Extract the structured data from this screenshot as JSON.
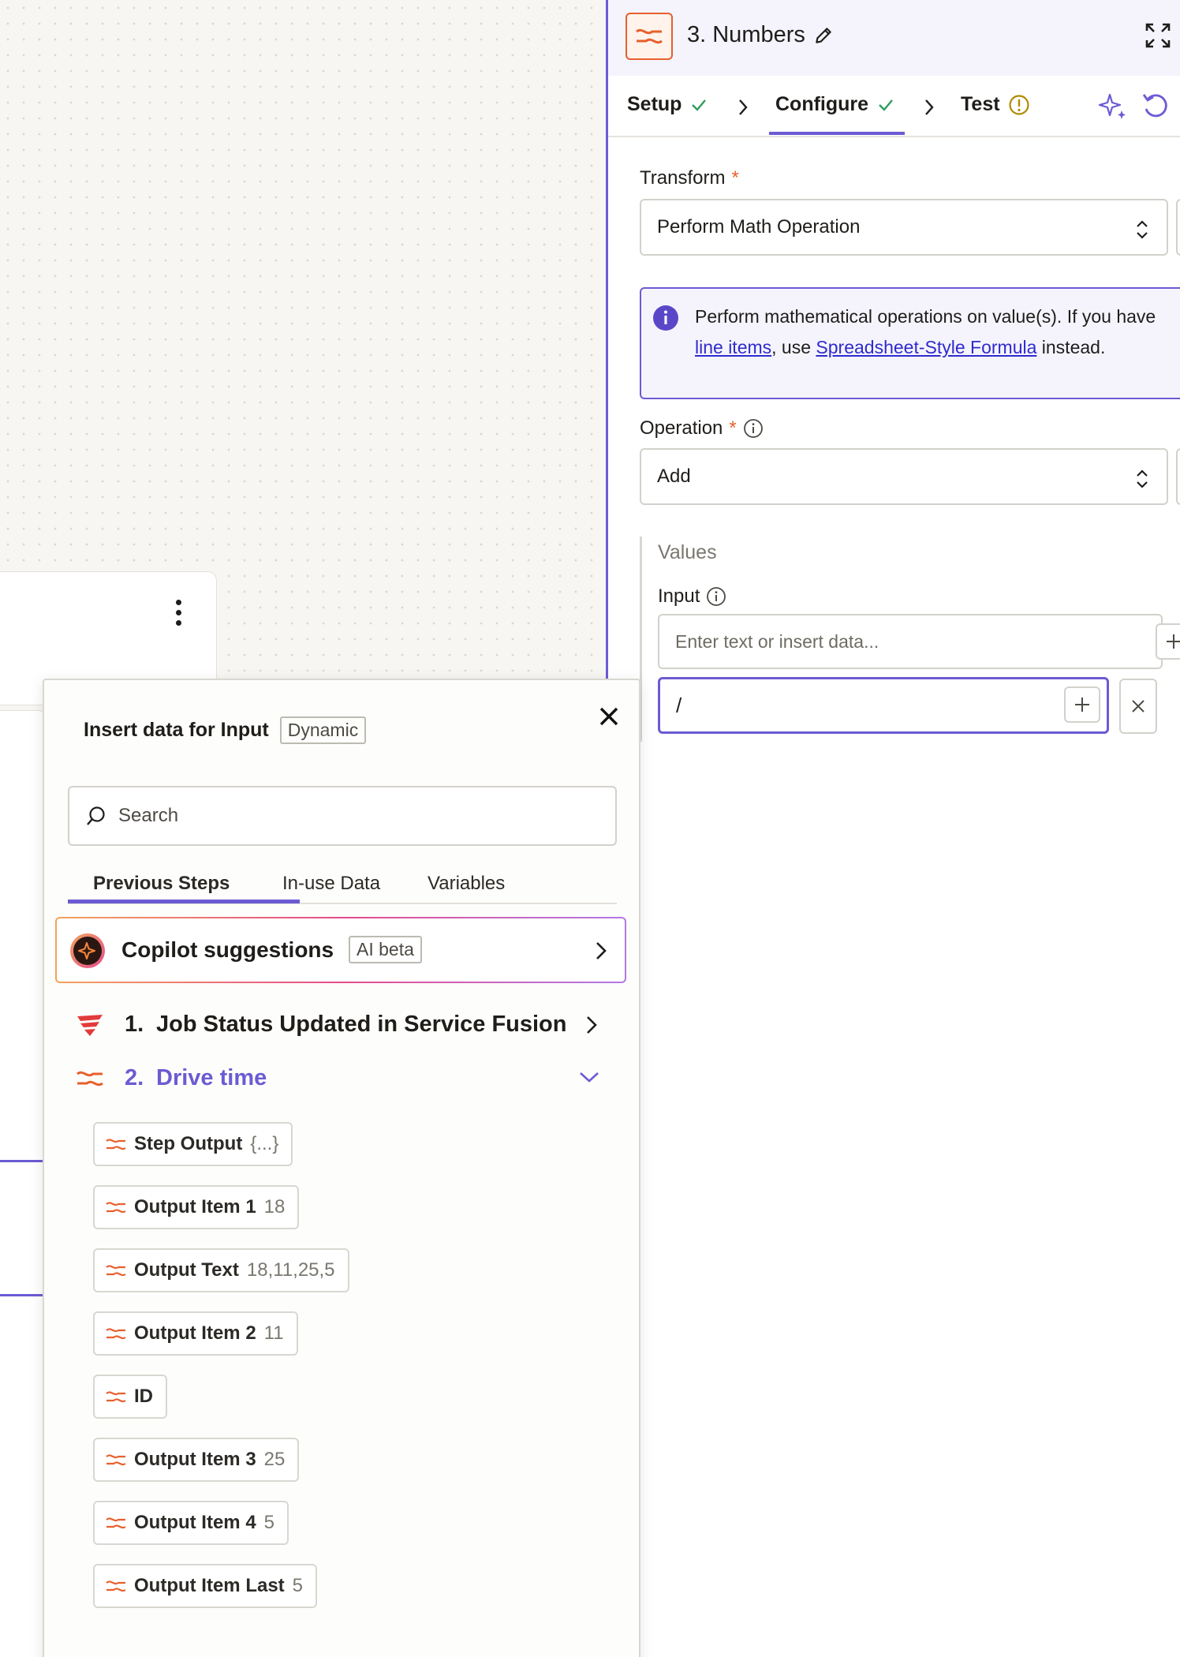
{
  "panel": {
    "title": "3. Numbers",
    "steps": [
      {
        "label": "Setup",
        "status": "done"
      },
      {
        "label": "Configure",
        "status": "done"
      },
      {
        "label": "Test",
        "status": "warning"
      }
    ],
    "transform": {
      "label": "Transform",
      "required_mark": "*",
      "value": "Perform Math Operation"
    },
    "info": {
      "text_before": "Perform mathematical operations on value(s). If you have ",
      "link1": "line items",
      "text_middle": ", use ",
      "link2": "Spreadsheet-Style Formula",
      "text_after": " instead."
    },
    "operation": {
      "label": "Operation",
      "required_mark": "*",
      "value": "Add"
    },
    "values": {
      "group_label": "Values",
      "input_label": "Input",
      "input_placeholder": "Enter text or insert data...",
      "active_input_value": "/"
    }
  },
  "popover": {
    "title": "Insert data for Input",
    "badge": "Dynamic",
    "search_placeholder": "Search",
    "tabs": [
      "Previous Steps",
      "In-use Data",
      "Variables"
    ],
    "copilot": {
      "label": "Copilot suggestions",
      "badge": "AI beta"
    },
    "step1": {
      "num": "1.",
      "title": "Job Status Updated in Service Fusion"
    },
    "step2": {
      "num": "2.",
      "title": "Drive time"
    },
    "fields": [
      {
        "name": "Step Output",
        "value": "{...}"
      },
      {
        "name": "Output Item 1",
        "value": "18"
      },
      {
        "name": "Output Text",
        "value": "18,11,25,5"
      },
      {
        "name": "Output Item 2",
        "value": "11"
      },
      {
        "name": "ID",
        "value": ""
      },
      {
        "name": "Output Item 3",
        "value": "25"
      },
      {
        "name": "Output Item 4",
        "value": "5"
      },
      {
        "name": "Output Item Last",
        "value": "5"
      }
    ]
  },
  "colors": {
    "accent": "#6b5bd3",
    "brand": "#e8602c",
    "link": "#2f2bcc"
  }
}
